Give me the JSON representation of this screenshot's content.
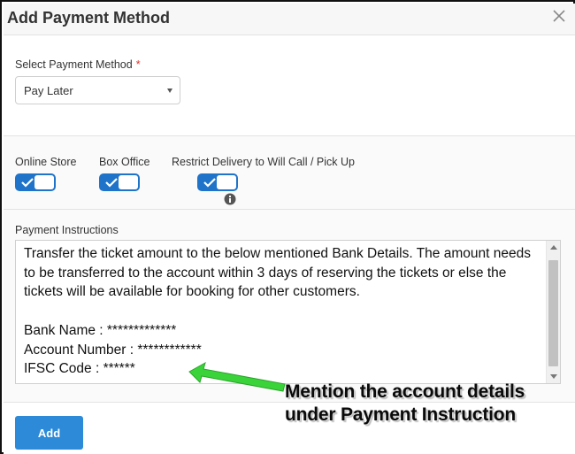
{
  "modal": {
    "title": "Add Payment Method",
    "close_icon": "close-icon"
  },
  "payment_method": {
    "label": "Select Payment Method",
    "required_marker": "*",
    "selected_value": "Pay Later"
  },
  "toggles": [
    {
      "label": "Online Store",
      "on": true
    },
    {
      "label": "Box Office",
      "on": true
    },
    {
      "label": "Restrict Delivery to Will Call / Pick Up",
      "on": true
    }
  ],
  "instructions": {
    "label": "Payment Instructions",
    "value": "Transfer the ticket amount to the below mentioned Bank Details. The amount needs to be transferred to the account within 3 days of reserving the tickets or else the tickets will be available for booking for other customers.\n\nBank Name : *************\nAccount Number : ************\nIFSC Code : ******"
  },
  "footer": {
    "add_label": "Add"
  },
  "annotation": {
    "line1": "Mention the account details",
    "line2": "under Payment Instruction"
  },
  "colors": {
    "accent": "#2c8ad9",
    "toggle": "#1f73c9",
    "required": "#d9322b",
    "arrow": "#33cc33"
  }
}
